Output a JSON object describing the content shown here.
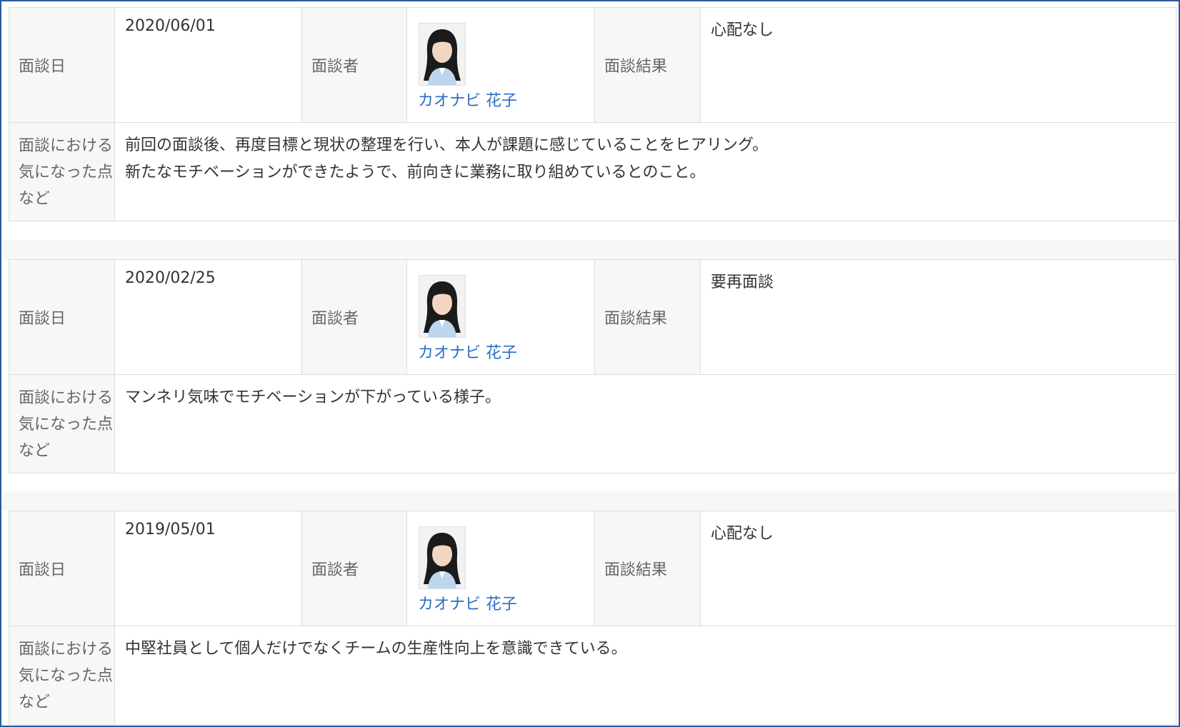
{
  "labels": {
    "interview_date": "面談日",
    "interviewer": "面談者",
    "result": "面談結果",
    "notes": "面談における気になった点など"
  },
  "records": [
    {
      "date": "2020/06/01",
      "interviewer_name": "カオナビ 花子",
      "result": "心配なし",
      "notes": [
        "前回の面談後、再度目標と現状の整理を行い、本人が課題に感じていることをヒアリング。",
        "新たなモチベーションができたようで、前向きに業務に取り組めているとのこと。"
      ]
    },
    {
      "date": "2020/02/25",
      "interviewer_name": "カオナビ 花子",
      "result": "要再面談",
      "notes": [
        "マンネリ気味でモチベーションが下がっている様子。"
      ]
    },
    {
      "date": "2019/05/01",
      "interviewer_name": "カオナビ 花子",
      "result": "心配なし",
      "notes": [
        "中堅社員として個人だけでなくチームの生産性向上を意識できている。"
      ]
    }
  ],
  "avatar_icon": "person-photo-icon",
  "colors": {
    "frame_border": "#2e5a9e",
    "link": "#2a6dc6",
    "label_bg": "#f7f7f5"
  }
}
